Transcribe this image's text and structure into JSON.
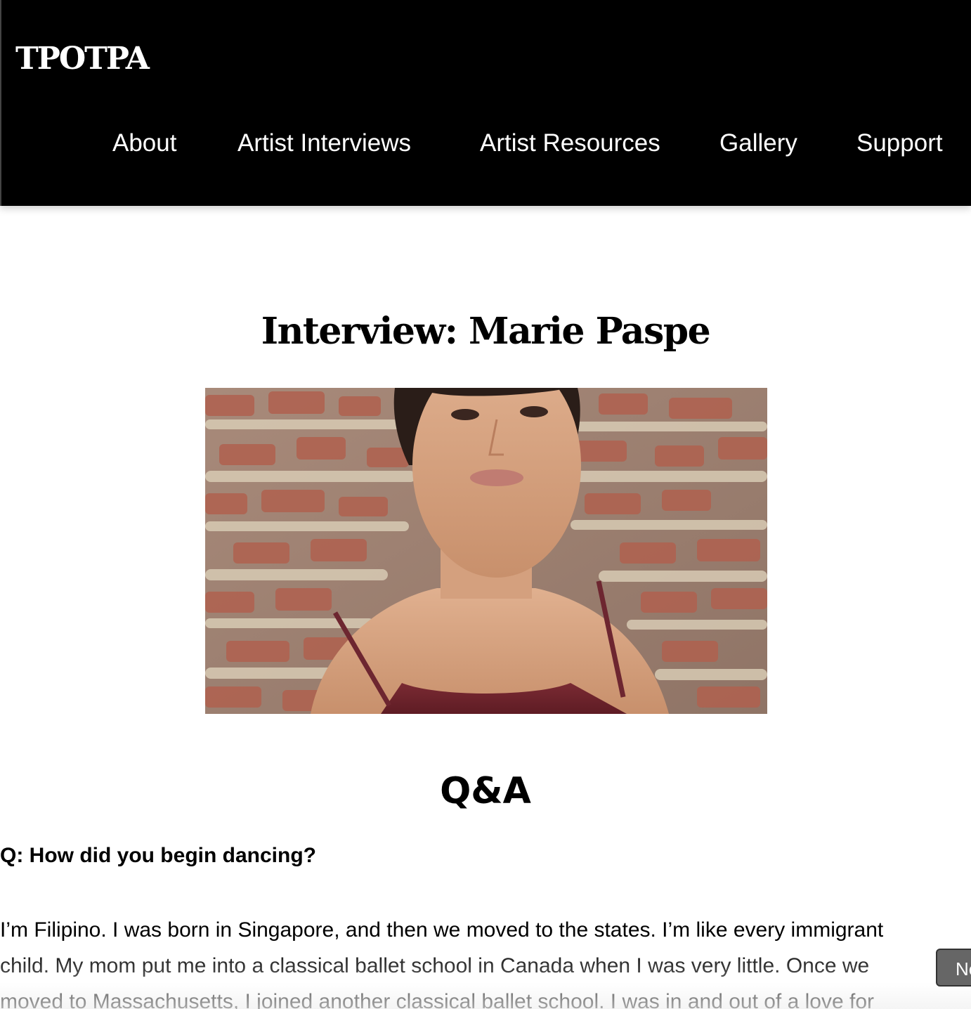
{
  "header": {
    "logo": "TPOTPA",
    "nav": [
      {
        "label": "About"
      },
      {
        "label": "Artist Interviews"
      },
      {
        "label": "Artist Resources"
      },
      {
        "label": "Gallery"
      },
      {
        "label": "Support"
      }
    ]
  },
  "article": {
    "title": "Interview: Marie Paspe",
    "section_heading": "Q&A",
    "question": "Q: How did you begin dancing?",
    "answer": "I’m Filipino. I was born in Singapore, and then we moved to the states. I’m like every immigrant child. My mom put me into a classical ballet school in Canada when I was very little. Once we moved to Massachusetts, I joined another classical ballet school. I was in and out of a love for"
  },
  "floating_button": {
    "label": "Ne"
  }
}
